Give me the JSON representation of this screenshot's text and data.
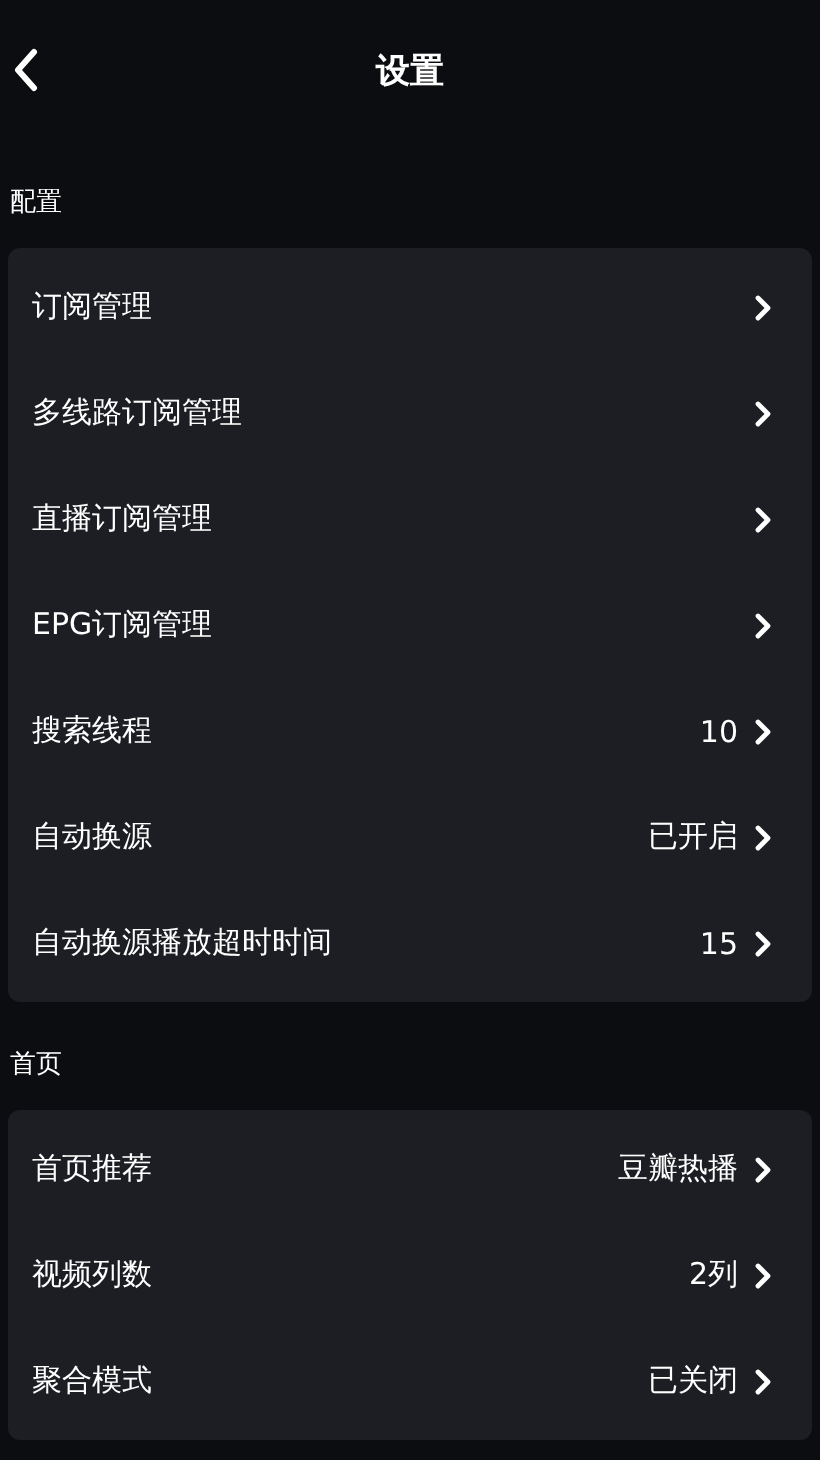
{
  "header": {
    "title": "设置"
  },
  "sections": [
    {
      "title": "配置",
      "items": [
        {
          "label": "订阅管理"
        },
        {
          "label": "多线路订阅管理"
        },
        {
          "label": "直播订阅管理"
        },
        {
          "label": "EPG订阅管理"
        },
        {
          "label": "搜索线程",
          "value": "10"
        },
        {
          "label": "自动换源",
          "value": "已开启"
        },
        {
          "label": "自动换源播放超时时间",
          "value": "15"
        }
      ]
    },
    {
      "title": "首页",
      "items": [
        {
          "label": "首页推荐",
          "value": "豆瓣热播"
        },
        {
          "label": "视频列数",
          "value": "2列"
        },
        {
          "label": "聚合模式",
          "value": "已关闭"
        }
      ]
    }
  ]
}
